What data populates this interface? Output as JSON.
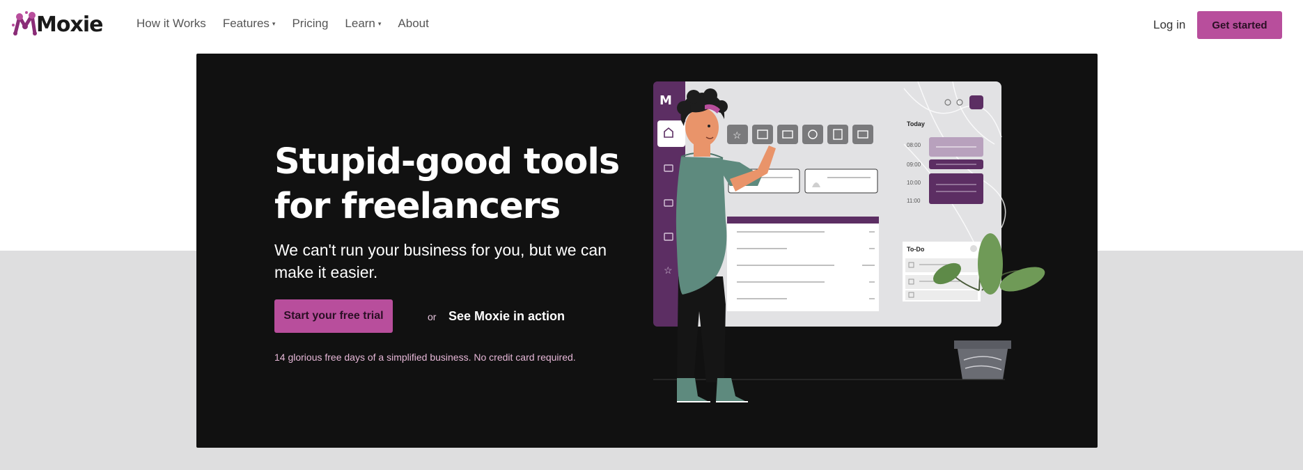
{
  "header": {
    "logo_text": "Moxie",
    "nav": [
      {
        "label": "How it Works",
        "has_dropdown": false
      },
      {
        "label": "Features",
        "has_dropdown": true
      },
      {
        "label": "Pricing",
        "has_dropdown": false
      },
      {
        "label": "Learn",
        "has_dropdown": true
      },
      {
        "label": "About",
        "has_dropdown": false
      }
    ],
    "login_label": "Log in",
    "get_started_label": "Get started"
  },
  "hero": {
    "headline": "Stupid-good tools for freelancers",
    "subheadline": "We can't run your business for you, but we can make it easier.",
    "cta_label": "Start your free trial",
    "or_text": "or",
    "secondary_link": "See Moxie in action",
    "trial_note": "14 glorious free days of a simplified business. No credit card required."
  },
  "illustration": {
    "calendar_title": "Today",
    "times": [
      "08:00",
      "09:00",
      "10:00",
      "11:00"
    ],
    "todo_title": "To-Do"
  },
  "colors": {
    "brand": "#b84e9c",
    "hero_bg": "#111111",
    "sidebar_purple": "#5c2e63",
    "lower_bg": "#dededf"
  }
}
